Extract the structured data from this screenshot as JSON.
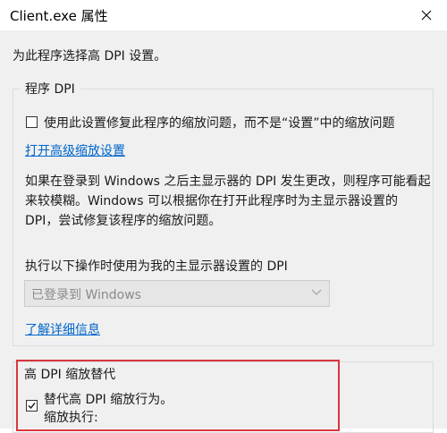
{
  "window": {
    "title": "Client.exe 属性",
    "close_icon": "close-icon"
  },
  "intro_text": "为此程序选择高 DPI 设置。",
  "program_dpi": {
    "group_title": "程序 DPI",
    "checkbox_label": "使用此设置修复此程序的缩放问题，而不是“设置”中的缩放问题",
    "checkbox_checked": false,
    "advanced_link": "打开高级缩放设置",
    "description": "如果在登录到 Windows 之后主显示器的 DPI 发生更改，则程序可能看起来较模糊。Windows 可以根据你在打开此程序时为主显示器设置的 DPI，尝试修复该程序的缩放问题。",
    "dropdown_label": "执行以下操作时使用为我的主显示器设置的 DPI",
    "dropdown_value": "已登录到 Windows",
    "learn_more_link": "了解详细信息"
  },
  "high_dpi_override": {
    "group_title": "高 DPI 缩放替代",
    "checkbox_label": "替代高 DPI 缩放行为。",
    "checkbox_checked": true,
    "scaling_label": "缩放执行:"
  },
  "colors": {
    "link": "#0066cc",
    "highlight": "#d9363e",
    "panel": "#f0f0f0"
  }
}
